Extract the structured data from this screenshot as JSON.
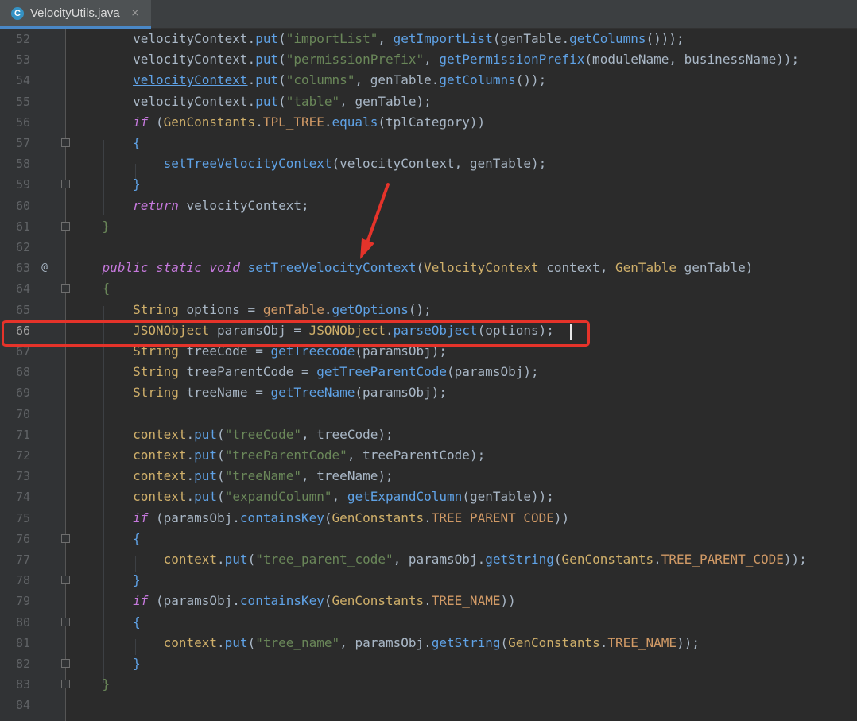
{
  "tab": {
    "icon_letter": "C",
    "title": "VelocityUtils.java",
    "close_glyph": "×"
  },
  "lines": [
    {
      "n": "52",
      "tokens": [
        [
          "        ",
          ""
        ],
        [
          "velocityContext.",
          ""
        ],
        [
          "put",
          "m"
        ],
        [
          "(",
          ""
        ],
        [
          "\"importList\"",
          "s"
        ],
        [
          ", ",
          ""
        ],
        [
          "getImportList",
          "m"
        ],
        [
          "(genTable.",
          ""
        ],
        [
          "getColumns",
          "m"
        ],
        [
          "()));",
          ""
        ]
      ]
    },
    {
      "n": "53",
      "tokens": [
        [
          "        ",
          ""
        ],
        [
          "velocityContext.",
          ""
        ],
        [
          "put",
          "m"
        ],
        [
          "(",
          ""
        ],
        [
          "\"permissionPrefix\"",
          "s"
        ],
        [
          ", ",
          ""
        ],
        [
          "getPermissionPrefix",
          "m"
        ],
        [
          "(moduleName, businessName));",
          ""
        ]
      ]
    },
    {
      "n": "54",
      "tokens": [
        [
          "        ",
          ""
        ],
        [
          "velocityContext",
          "u"
        ],
        [
          ".",
          ""
        ],
        [
          "put",
          "m"
        ],
        [
          "(",
          ""
        ],
        [
          "\"columns\"",
          "s"
        ],
        [
          ", genTable.",
          ""
        ],
        [
          "getColumns",
          "m"
        ],
        [
          "());",
          ""
        ]
      ]
    },
    {
      "n": "55",
      "tokens": [
        [
          "        ",
          ""
        ],
        [
          "velocityContext.",
          ""
        ],
        [
          "put",
          "m"
        ],
        [
          "(",
          ""
        ],
        [
          "\"table\"",
          "s"
        ],
        [
          ", genTable);",
          ""
        ]
      ]
    },
    {
      "n": "56",
      "tokens": [
        [
          "        ",
          ""
        ],
        [
          "if",
          "ki"
        ],
        [
          " (",
          ""
        ],
        [
          "GenConstants",
          "c"
        ],
        [
          ".",
          ""
        ],
        [
          "TPL_TREE",
          "v"
        ],
        [
          ".",
          ""
        ],
        [
          "equals",
          "m"
        ],
        [
          "(tplCategory))",
          ""
        ]
      ]
    },
    {
      "n": "57",
      "tokens": [
        [
          "        ",
          ""
        ],
        [
          "{",
          "m"
        ]
      ],
      "fold": true
    },
    {
      "n": "58",
      "tokens": [
        [
          "            ",
          ""
        ],
        [
          "setTreeVelocityContext",
          "m"
        ],
        [
          "(velocityContext, genTable);",
          ""
        ]
      ]
    },
    {
      "n": "59",
      "tokens": [
        [
          "        ",
          ""
        ],
        [
          "}",
          "m"
        ]
      ],
      "fold": true
    },
    {
      "n": "60",
      "tokens": [
        [
          "        ",
          ""
        ],
        [
          "return",
          "ki"
        ],
        [
          " velocityContext;",
          ""
        ]
      ]
    },
    {
      "n": "61",
      "tokens": [
        [
          "    ",
          ""
        ],
        [
          "}",
          "s"
        ]
      ],
      "fold": true
    },
    {
      "n": "62",
      "tokens": []
    },
    {
      "n": "63",
      "tokens": [
        [
          "    ",
          ""
        ],
        [
          "public static void",
          "ki"
        ],
        [
          " ",
          ""
        ],
        [
          "setTreeVelocityContext",
          "m"
        ],
        [
          "(",
          ""
        ],
        [
          "VelocityContext",
          "c"
        ],
        [
          " context, ",
          ""
        ],
        [
          "GenTable",
          "c"
        ],
        [
          " genTable)",
          ""
        ]
      ],
      "marker": "@"
    },
    {
      "n": "64",
      "tokens": [
        [
          "    ",
          ""
        ],
        [
          "{",
          "s"
        ]
      ],
      "fold": true
    },
    {
      "n": "65",
      "tokens": [
        [
          "        ",
          ""
        ],
        [
          "String",
          "c"
        ],
        [
          " options = ",
          ""
        ],
        [
          "genTable",
          "v"
        ],
        [
          ".",
          ""
        ],
        [
          "getOptions",
          "m"
        ],
        [
          "();",
          ""
        ]
      ]
    },
    {
      "n": "66",
      "tokens": [
        [
          "        ",
          ""
        ],
        [
          "JSONObject",
          "c"
        ],
        [
          " paramsObj = ",
          ""
        ],
        [
          "JSONObject",
          "c"
        ],
        [
          ".",
          ""
        ],
        [
          "parseObject",
          "m"
        ],
        [
          "(options);",
          ""
        ]
      ]
    },
    {
      "n": "67",
      "tokens": [
        [
          "        ",
          ""
        ],
        [
          "String",
          "c"
        ],
        [
          " treeCode = ",
          ""
        ],
        [
          "getTreecode",
          "m"
        ],
        [
          "(paramsObj);",
          ""
        ]
      ]
    },
    {
      "n": "68",
      "tokens": [
        [
          "        ",
          ""
        ],
        [
          "String",
          "c"
        ],
        [
          " treeParentCode = ",
          ""
        ],
        [
          "getTreeParentCode",
          "m"
        ],
        [
          "(paramsObj);",
          ""
        ]
      ]
    },
    {
      "n": "69",
      "tokens": [
        [
          "        ",
          ""
        ],
        [
          "String",
          "c"
        ],
        [
          " treeName = ",
          ""
        ],
        [
          "getTreeName",
          "m"
        ],
        [
          "(paramsObj);",
          ""
        ]
      ]
    },
    {
      "n": "70",
      "tokens": []
    },
    {
      "n": "71",
      "tokens": [
        [
          "        ",
          ""
        ],
        [
          "context",
          "c"
        ],
        [
          ".",
          ""
        ],
        [
          "put",
          "m"
        ],
        [
          "(",
          ""
        ],
        [
          "\"treeCode\"",
          "s"
        ],
        [
          ", treeCode);",
          ""
        ]
      ]
    },
    {
      "n": "72",
      "tokens": [
        [
          "        ",
          ""
        ],
        [
          "context",
          "c"
        ],
        [
          ".",
          ""
        ],
        [
          "put",
          "m"
        ],
        [
          "(",
          ""
        ],
        [
          "\"treeParentCode\"",
          "s"
        ],
        [
          ", treeParentCode);",
          ""
        ]
      ]
    },
    {
      "n": "73",
      "tokens": [
        [
          "        ",
          ""
        ],
        [
          "context",
          "c"
        ],
        [
          ".",
          ""
        ],
        [
          "put",
          "m"
        ],
        [
          "(",
          ""
        ],
        [
          "\"treeName\"",
          "s"
        ],
        [
          ", treeName);",
          ""
        ]
      ]
    },
    {
      "n": "74",
      "tokens": [
        [
          "        ",
          ""
        ],
        [
          "context",
          "c"
        ],
        [
          ".",
          ""
        ],
        [
          "put",
          "m"
        ],
        [
          "(",
          ""
        ],
        [
          "\"expandColumn\"",
          "s"
        ],
        [
          ", ",
          ""
        ],
        [
          "getExpandColumn",
          "m"
        ],
        [
          "(genTable));",
          ""
        ]
      ]
    },
    {
      "n": "75",
      "tokens": [
        [
          "        ",
          ""
        ],
        [
          "if",
          "ki"
        ],
        [
          " (paramsObj.",
          ""
        ],
        [
          "containsKey",
          "m"
        ],
        [
          "(",
          ""
        ],
        [
          "GenConstants",
          "c"
        ],
        [
          ".",
          ""
        ],
        [
          "TREE_PARENT_CODE",
          "v"
        ],
        [
          "))",
          ""
        ]
      ]
    },
    {
      "n": "76",
      "tokens": [
        [
          "        ",
          ""
        ],
        [
          "{",
          "m"
        ]
      ],
      "fold": true
    },
    {
      "n": "77",
      "tokens": [
        [
          "            ",
          ""
        ],
        [
          "context",
          "c"
        ],
        [
          ".",
          ""
        ],
        [
          "put",
          "m"
        ],
        [
          "(",
          ""
        ],
        [
          "\"tree_parent_code\"",
          "s"
        ],
        [
          ", paramsObj.",
          ""
        ],
        [
          "getString",
          "m"
        ],
        [
          "(",
          ""
        ],
        [
          "GenConstants",
          "c"
        ],
        [
          ".",
          ""
        ],
        [
          "TREE_PARENT_CODE",
          "v"
        ],
        [
          "));",
          ""
        ]
      ]
    },
    {
      "n": "78",
      "tokens": [
        [
          "        ",
          ""
        ],
        [
          "}",
          "m"
        ]
      ],
      "fold": true
    },
    {
      "n": "79",
      "tokens": [
        [
          "        ",
          ""
        ],
        [
          "if",
          "ki"
        ],
        [
          " (paramsObj.",
          ""
        ],
        [
          "containsKey",
          "m"
        ],
        [
          "(",
          ""
        ],
        [
          "GenConstants",
          "c"
        ],
        [
          ".",
          ""
        ],
        [
          "TREE_NAME",
          "v"
        ],
        [
          "))",
          ""
        ]
      ]
    },
    {
      "n": "80",
      "tokens": [
        [
          "        ",
          ""
        ],
        [
          "{",
          "m"
        ]
      ],
      "fold": true
    },
    {
      "n": "81",
      "tokens": [
        [
          "            ",
          ""
        ],
        [
          "context",
          "c"
        ],
        [
          ".",
          ""
        ],
        [
          "put",
          "m"
        ],
        [
          "(",
          ""
        ],
        [
          "\"tree_name\"",
          "s"
        ],
        [
          ", paramsObj.",
          ""
        ],
        [
          "getString",
          "m"
        ],
        [
          "(",
          ""
        ],
        [
          "GenConstants",
          "c"
        ],
        [
          ".",
          ""
        ],
        [
          "TREE_NAME",
          "v"
        ],
        [
          "));",
          ""
        ]
      ]
    },
    {
      "n": "82",
      "tokens": [
        [
          "        ",
          ""
        ],
        [
          "}",
          "m"
        ]
      ],
      "fold": true
    },
    {
      "n": "83",
      "tokens": [
        [
          "    ",
          ""
        ],
        [
          "}",
          "s"
        ]
      ],
      "fold": true
    },
    {
      "n": "84",
      "tokens": []
    }
  ],
  "highlight": {
    "line": "66",
    "color": "#e5332a"
  },
  "colors": {
    "background": "#2b2b2b",
    "gutter": "#313335",
    "annotation_red": "#e5332a"
  }
}
